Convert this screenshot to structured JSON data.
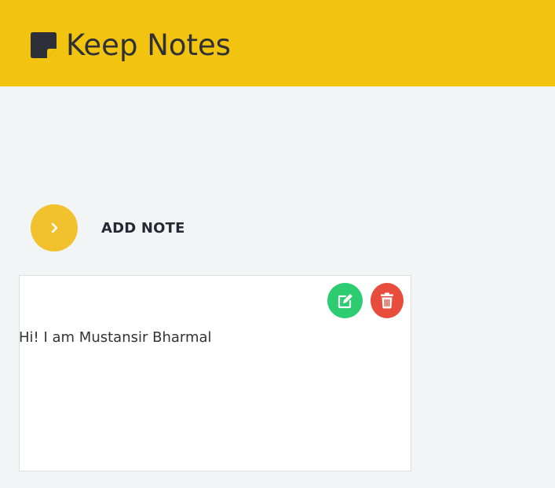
{
  "header": {
    "title": "Keep Notes",
    "logo_icon": "sticky-note-icon",
    "background_color": "#f2c40f"
  },
  "add_note": {
    "label": "ADD NOTE",
    "icon": "chevron-right-icon",
    "circle_color": "#f2c12e"
  },
  "notes": [
    {
      "text": "Hi! I am Mustansir Bharmal",
      "edit_icon": "edit-icon",
      "delete_icon": "trash-icon",
      "edit_color": "#2ecc71",
      "delete_color": "#e74c3c"
    }
  ]
}
